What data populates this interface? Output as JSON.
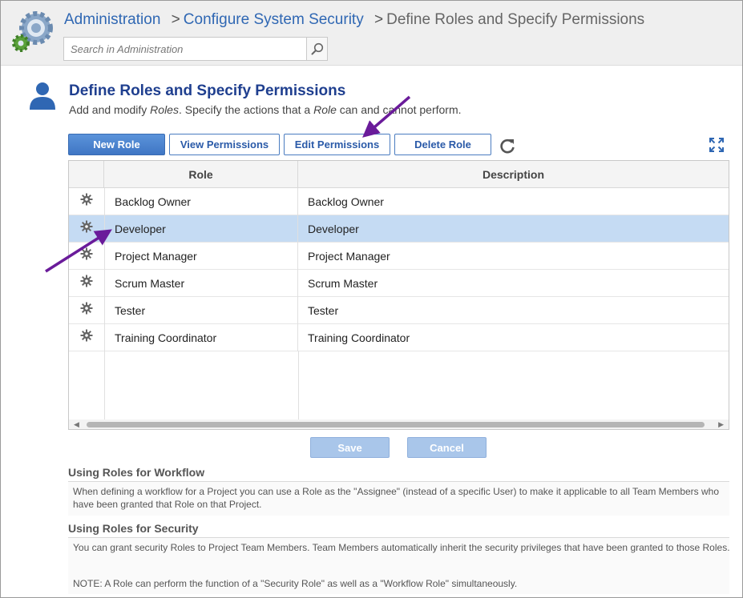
{
  "header": {
    "breadcrumb": [
      {
        "label": "Administration",
        "link": true
      },
      {
        "sep": ">",
        "label": "Configure System Security",
        "link": true
      },
      {
        "sep": ">",
        "label": "Define Roles and Specify Permissions",
        "link": false
      }
    ],
    "search_placeholder": "Search in Administration"
  },
  "page": {
    "title": "Define Roles and Specify Permissions",
    "subtitle_parts": [
      "Add and modify ",
      "Roles",
      ". Specify the actions that a ",
      "Role",
      " can and cannot perform."
    ]
  },
  "toolbar": {
    "new_role": "New Role",
    "view_permissions": "View Permissions",
    "edit_permissions": "Edit Permissions",
    "delete_role": "Delete Role"
  },
  "grid": {
    "columns": [
      "Role",
      "Description"
    ],
    "rows": [
      {
        "role": "Backlog Owner",
        "description": "Backlog Owner",
        "selected": false
      },
      {
        "role": "Developer",
        "description": "Developer",
        "selected": true
      },
      {
        "role": "Project Manager",
        "description": "Project Manager",
        "selected": false
      },
      {
        "role": "Scrum Master",
        "description": "Scrum Master",
        "selected": false
      },
      {
        "role": "Tester",
        "description": "Tester",
        "selected": false
      },
      {
        "role": "Training Coordinator",
        "description": "Training Coordinator",
        "selected": false
      }
    ]
  },
  "form": {
    "save": "Save",
    "cancel": "Cancel"
  },
  "help": {
    "workflow_heading": "Using Roles for Workflow",
    "workflow_text": "When defining a workflow for a Project you can use a Role as the \"Assignee\" (instead of a specific User) to make it applicable to all Team Members who have been granted that Role on that Project.",
    "security_heading": "Using Roles for Security",
    "security_text": "You can grant security Roles to Project Team Members. Team Members automatically inherit the security privileges that have been granted to those Roles.",
    "note_text": "NOTE: A Role can perform the function of a \"Security Role\" as well as a \"Workflow Role\" simultaneously."
  },
  "colors": {
    "link": "#2f67b3",
    "title": "#1f3f8f",
    "primary_button": "#4a82cf",
    "selected_row": "#c5dbf3",
    "annotation_arrow": "#6a1b9a"
  },
  "icons": [
    "admin-gear-icon",
    "search-icon",
    "user-icon",
    "refresh-icon",
    "expand-icon",
    "row-gear-icon"
  ]
}
